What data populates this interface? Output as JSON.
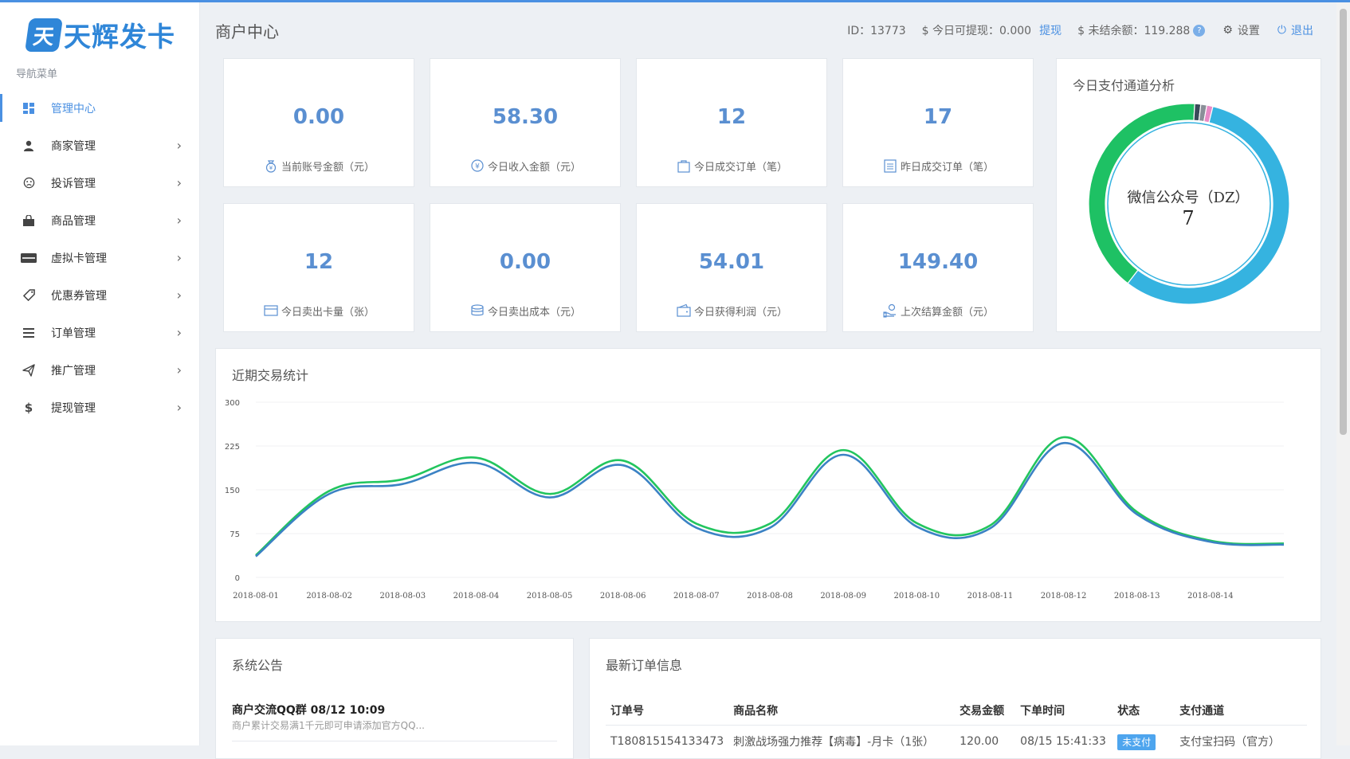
{
  "app": {
    "logo_glyph": "天",
    "logo_text": "天辉发卡",
    "nav_title": "导航菜单",
    "accent_color": "#4a90e2"
  },
  "sidebar": {
    "items": [
      {
        "label": "管理中心",
        "icon": "dashboard-icon",
        "active": true
      },
      {
        "label": "商家管理",
        "icon": "user-icon"
      },
      {
        "label": "投诉管理",
        "icon": "frown-icon"
      },
      {
        "label": "商品管理",
        "icon": "shopping-bag-icon"
      },
      {
        "label": "虚拟卡管理",
        "icon": "card-icon"
      },
      {
        "label": "优惠券管理",
        "icon": "tag-icon"
      },
      {
        "label": "订单管理",
        "icon": "list-icon"
      },
      {
        "label": "推广管理",
        "icon": "paper-plane-icon"
      },
      {
        "label": "提现管理",
        "icon": "dollar-icon"
      }
    ]
  },
  "header": {
    "title": "商户中心",
    "id_text": "ID：13773",
    "withdrawable": "$ 今日可提现：0.000",
    "withdraw_link": "提现",
    "unsettled": "$ 未结余额：119.288",
    "help": "?",
    "settings": "设置",
    "logout": "退出"
  },
  "stats": [
    {
      "value": "0.00",
      "label": "当前账号金额（元）",
      "icon": "money-bag-icon"
    },
    {
      "value": "58.30",
      "label": "今日收入金额（元）",
      "icon": "yuan-coin-icon"
    },
    {
      "value": "12",
      "label": "今日成交订单（笔）",
      "icon": "shopping-bag-icon"
    },
    {
      "value": "17",
      "label": "昨日成交订单（笔）",
      "icon": "list-doc-icon"
    },
    {
      "value": "12",
      "label": "今日卖出卡量（张）",
      "icon": "card-icon"
    },
    {
      "value": "0.00",
      "label": "今日卖出成本（元）",
      "icon": "coins-stack-icon"
    },
    {
      "value": "54.01",
      "label": "今日获得利润（元）",
      "icon": "wallet-icon"
    },
    {
      "value": "149.40",
      "label": "上次结算金额（元）",
      "icon": "hand-money-icon"
    }
  ],
  "donut": {
    "title": "今日支付通道分析",
    "center_label": "微信公众号（DZ）",
    "center_value": "7"
  },
  "trend": {
    "title": "近期交易统计"
  },
  "chart_data": {
    "type": "line",
    "x": [
      "2018-08-01",
      "2018-08-02",
      "2018-08-03",
      "2018-08-04",
      "2018-08-05",
      "2018-08-06",
      "2018-08-07",
      "2018-08-08",
      "2018-08-09",
      "2018-08-10",
      "2018-08-11",
      "2018-08-12",
      "2018-08-13",
      "2018-08-14",
      "2018-08-15"
    ],
    "x_tick_labels": [
      "2018-08-01",
      "2018-08-02",
      "2018-08-03",
      "2018-08-04",
      "2018-08-05",
      "2018-08-06",
      "2018-08-07",
      "2018-08-08",
      "2018-08-09",
      "2018-08-10",
      "2018-08-11",
      "2018-08-12",
      "2018-08-13",
      "2018-08-14"
    ],
    "yticks": [
      "0",
      "75",
      "150",
      "225",
      "300"
    ],
    "ylim": [
      0,
      300
    ],
    "series": [
      {
        "color": "#22c55e",
        "values": [
          38,
          148,
          168,
          205,
          143,
          200,
          92,
          92,
          218,
          93,
          89,
          240,
          112,
          63,
          58
        ]
      },
      {
        "color": "#3b82c4",
        "values": [
          36,
          143,
          160,
          196,
          137,
          192,
          85,
          85,
          210,
          87,
          84,
          230,
          108,
          61,
          56
        ]
      }
    ],
    "donut_segments": [
      {
        "value": 7,
        "color": "#35b3e0"
      },
      {
        "value": 5,
        "color": "#1ec164"
      },
      {
        "value": 0.12,
        "color": "#3a4a5a"
      },
      {
        "value": 0.12,
        "color": "#8a8f98"
      },
      {
        "value": 0.12,
        "color": "#e98ac7"
      }
    ]
  },
  "notice": {
    "title": "系统公告",
    "item_title": "商户交流QQ群 08/12 10:09",
    "item_desc": "商户累计交易满1千元即可申请添加官方QQ..."
  },
  "orders": {
    "title": "最新订单信息",
    "columns": [
      "订单号",
      "商品名称",
      "交易金额",
      "下单时间",
      "状态",
      "支付通道"
    ],
    "rows": [
      [
        "T180815154133473",
        "刺激战场强力推荐【病毒】-月卡（1张）",
        "120.00",
        "08/15 15:41:33",
        "未支付",
        "支付宝扫码（官方）"
      ]
    ]
  }
}
